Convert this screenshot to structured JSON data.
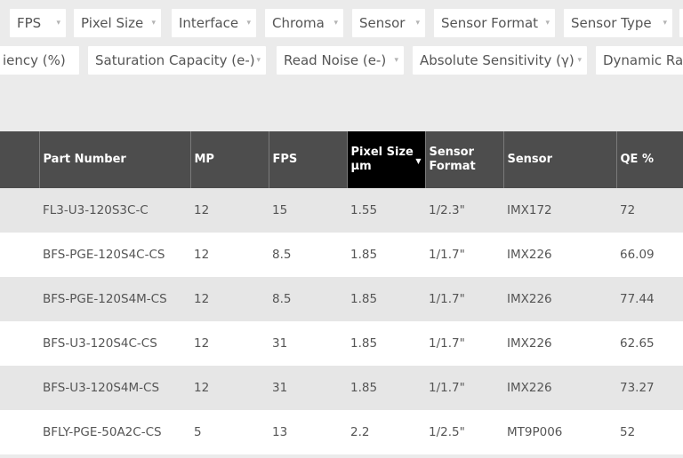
{
  "filters": {
    "row1": [
      {
        "label": "FPS"
      },
      {
        "label": "Pixel Size"
      },
      {
        "label": "Interface"
      },
      {
        "label": "Chroma"
      },
      {
        "label": "Sensor"
      },
      {
        "label": "Sensor Format"
      },
      {
        "label": "Sensor Type"
      }
    ],
    "row2": [
      {
        "label": "iency (%)"
      },
      {
        "label": "Saturation Capacity (e-)"
      },
      {
        "label": "Read Noise (e-)"
      },
      {
        "label": "Absolute Sensitivity (γ)"
      },
      {
        "label": "Dynamic Range"
      }
    ],
    "caret": "▾"
  },
  "table": {
    "headers": {
      "part": "Part Number",
      "mp": "MP",
      "fps": "FPS",
      "pixel_size": "Pixel Size µm",
      "sensor_format": "Sensor Format",
      "sensor": "Sensor",
      "qe": "QE %"
    },
    "sorted_column": "pixel_size",
    "sort_arrow": "▼",
    "rows": [
      {
        "part": "FL3-U3-120S3C-C",
        "mp": "12",
        "fps": "15",
        "pixel_size": "1.55",
        "sensor_format": "1/2.3\"",
        "sensor": "IMX172",
        "qe": "72"
      },
      {
        "part": "BFS-PGE-120S4C-CS",
        "mp": "12",
        "fps": "8.5",
        "pixel_size": "1.85",
        "sensor_format": "1/1.7\"",
        "sensor": "IMX226",
        "qe": "66.09"
      },
      {
        "part": "BFS-PGE-120S4M-CS",
        "mp": "12",
        "fps": "8.5",
        "pixel_size": "1.85",
        "sensor_format": "1/1.7\"",
        "sensor": "IMX226",
        "qe": "77.44"
      },
      {
        "part": "BFS-U3-120S4C-CS",
        "mp": "12",
        "fps": "31",
        "pixel_size": "1.85",
        "sensor_format": "1/1.7\"",
        "sensor": "IMX226",
        "qe": "62.65"
      },
      {
        "part": "BFS-U3-120S4M-CS",
        "mp": "12",
        "fps": "31",
        "pixel_size": "1.85",
        "sensor_format": "1/1.7\"",
        "sensor": "IMX226",
        "qe": "73.27"
      },
      {
        "part": "BFLY-PGE-50A2C-CS",
        "mp": "5",
        "fps": "13",
        "pixel_size": "2.2",
        "sensor_format": "1/2.5\"",
        "sensor": "MT9P006",
        "qe": "52"
      }
    ]
  },
  "colors": {
    "header_bg": "#4d4d4d",
    "sorted_header_bg": "#000000",
    "row_odd": "#e6e6e6",
    "row_even": "#ffffff",
    "page_bg": "#ebebeb"
  }
}
